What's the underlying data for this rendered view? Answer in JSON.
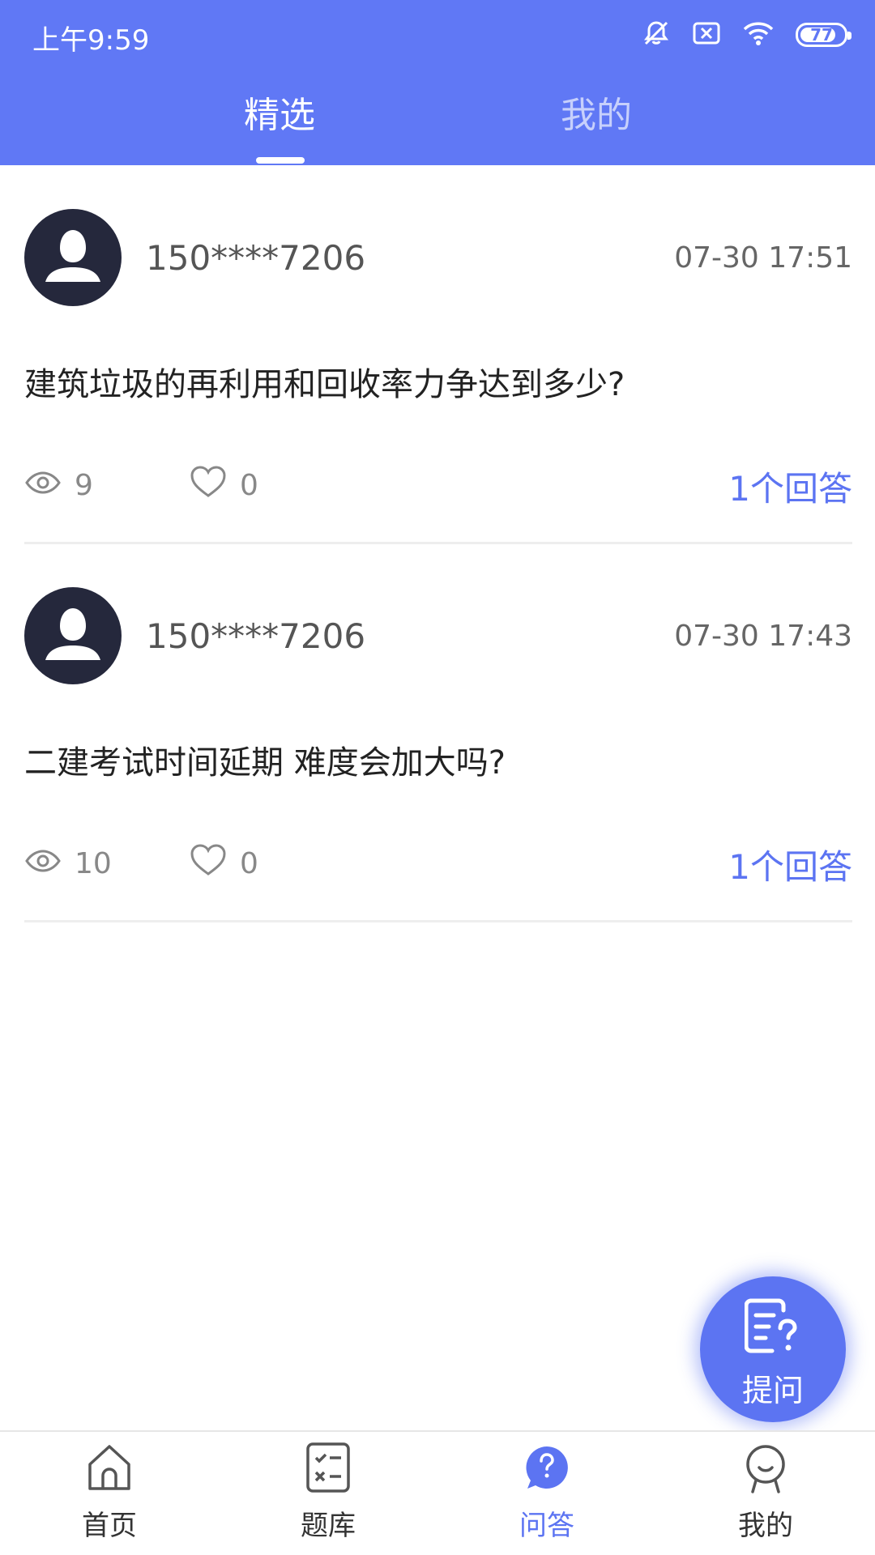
{
  "status_bar": {
    "time": "上午9:59",
    "battery": "77"
  },
  "tabs": [
    {
      "label": "精选",
      "active": true
    },
    {
      "label": "我的",
      "active": false
    }
  ],
  "posts": [
    {
      "username": "150****7206",
      "timestamp": "07-30 17:51",
      "question": "建筑垃圾的再利用和回收率力争达到多少?",
      "views": "9",
      "likes": "0",
      "answers": "1个回答"
    },
    {
      "username": "150****7206",
      "timestamp": "07-30 17:43",
      "question": "二建考试时间延期 难度会加大吗?",
      "views": "10",
      "likes": "0",
      "answers": "1个回答"
    }
  ],
  "fab": {
    "label": "提问",
    "icon": "ask-question-icon"
  },
  "bottom_nav": [
    {
      "label": "首页",
      "icon": "home-icon",
      "active": false
    },
    {
      "label": "题库",
      "icon": "question-bank-icon",
      "active": false
    },
    {
      "label": "问答",
      "icon": "qa-icon",
      "active": true
    },
    {
      "label": "我的",
      "icon": "profile-icon",
      "active": false
    }
  ],
  "colors": {
    "header": "#6078f5",
    "accent": "#5c74f2",
    "avatar": "#25283c"
  }
}
